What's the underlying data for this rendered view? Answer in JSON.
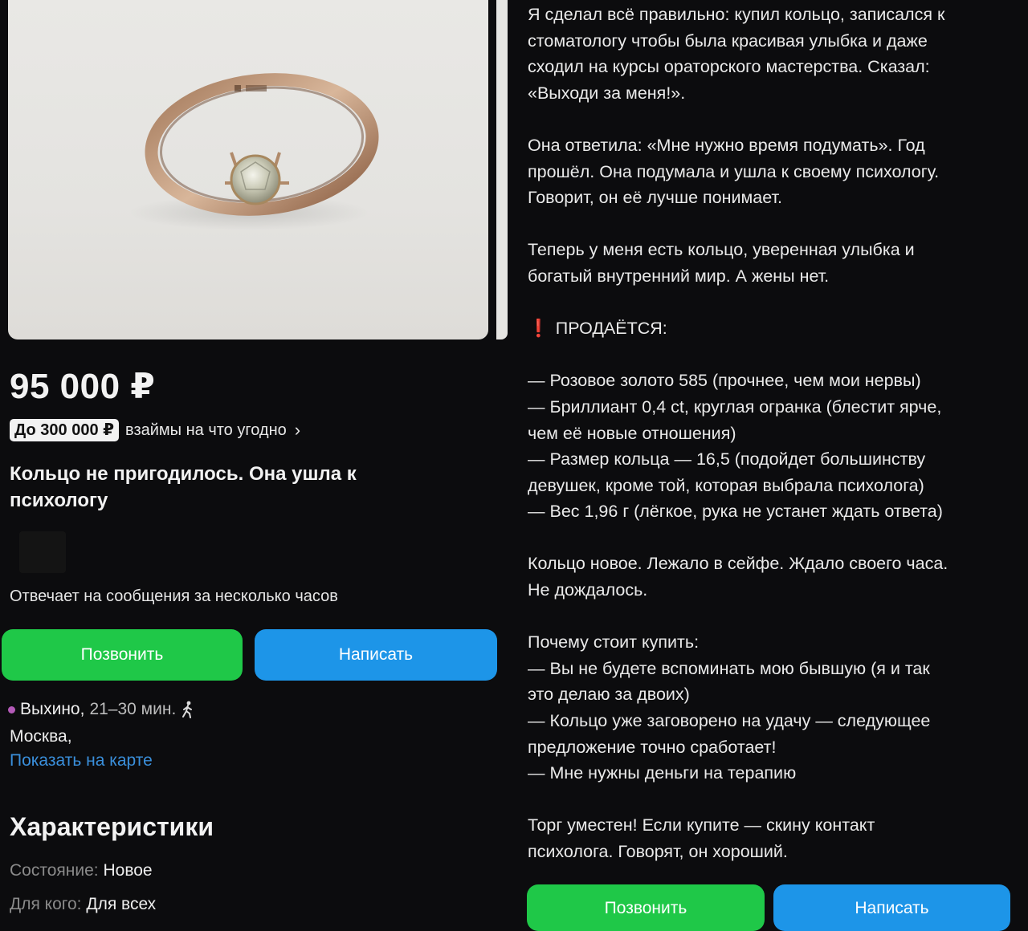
{
  "listing": {
    "price": "95 000 ₽",
    "loan_badge": "До 300 000 ₽",
    "loan_text": "взаймы на что угодно",
    "title": "Кольцо не пригодилось. Она ушла к психологу",
    "seller_replies": "Отвечает на сообщения за несколько часов",
    "call_button": "Позвонить",
    "write_button": "Написать",
    "metro_station": "Выхино,",
    "metro_time": "21–30 мин.",
    "city": "Москва,",
    "show_on_map": "Показать на карте",
    "characteristics_title": "Характеристики",
    "characteristics": [
      {
        "key": "Состояние:",
        "value": "Новое"
      },
      {
        "key": "Для кого:",
        "value": "Для всех"
      }
    ]
  },
  "description": {
    "paragraph_1": [
      "Я сделал всё правильно: купил кольцо, записался к",
      "стоматологу чтобы была красивая улыбка и даже",
      "сходил на курсы ораторского мастерства. Сказал:",
      "«Выходи за меня!»."
    ],
    "paragraph_2": [
      "Она ответила: «Мне нужно время подумать». Год",
      "прошёл. Она подумала и ушла к своему психологу.",
      "Говорит, он её лучше понимает."
    ],
    "paragraph_3": [
      "Теперь у меня есть кольцо, уверенная улыбка и",
      "богатый внутренний мир. А жены нет."
    ],
    "sale_mark": "❗",
    "sale_heading": "ПРОДАЁТСЯ:",
    "features": [
      "— Розовое золото 585 (прочнее, чем мои нервы)",
      "— Бриллиант 0,4 ct, круглая огранка (блестит ярче,",
      "чем её новые отношения)",
      "— Размер кольца — 16,5 (подойдет большинству",
      "девушек, кроме той, которая выбрала психолога)",
      "— Вес 1,96 г (лёгкое, рука не устанет ждать ответа)"
    ],
    "paragraph_4": [
      "Кольцо новое. Лежало в сейфе. Ждало своего часа.",
      "Не дождалось."
    ],
    "why_buy": [
      "Почему стоит купить:",
      "— Вы не будете вспоминать мою бывшую (я и так",
      "это делаю за двоих)",
      "— Кольцо уже заговорено на удачу — следующее",
      "предложение точно сработает!",
      "— Мне нужны деньги на терапию"
    ],
    "closing": [
      "Торг уместен! Если купите — скину контакт",
      "психолога. Говорят, он хороший."
    ]
  },
  "icons": {
    "walk": "walking-person-icon",
    "chevron": "chevron-right-icon",
    "metro_dot_color": "#b45ab8"
  },
  "colors": {
    "call": "#1fc848",
    "write": "#1d95e8",
    "link": "#3a8fdb",
    "accent_red": "#e0312b"
  }
}
